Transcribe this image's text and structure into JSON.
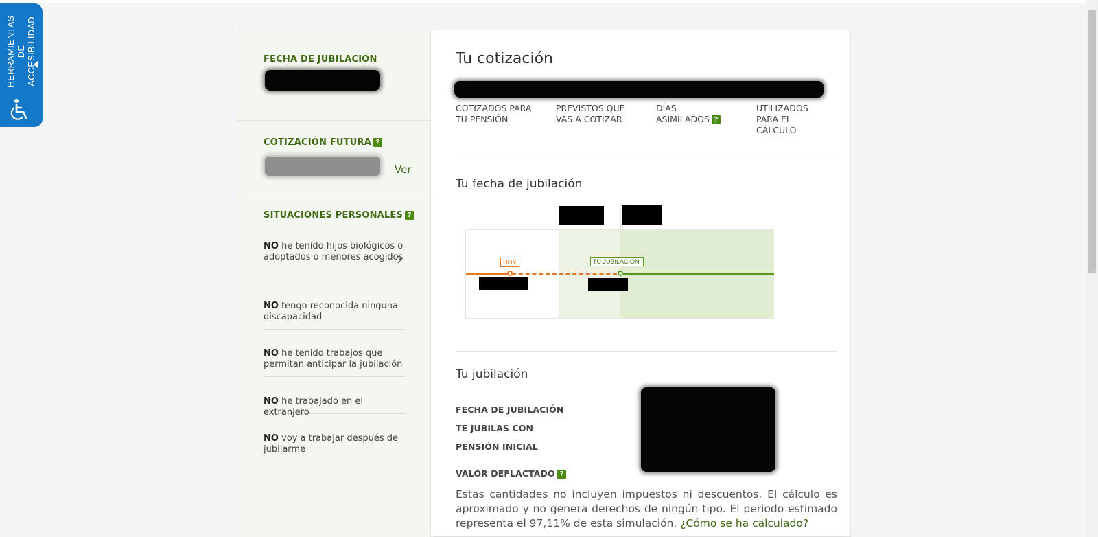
{
  "accessibility": {
    "label": "Herramientas de accesibilidad"
  },
  "sidebar": {
    "retirement_date": {
      "label": "FECHA DE JUBILACIÓN"
    },
    "future_contribution": {
      "label": "COTIZACIÓN FUTURA",
      "help": "?",
      "link": "Ver"
    },
    "personal_situations": {
      "label": "SITUACIONES PERSONALES",
      "help": "?",
      "items": [
        {
          "prefix": "NO",
          "text": "he tenido hijos biológicos o adoptados o menores acogidos"
        },
        {
          "prefix": "NO",
          "text": "tengo reconocida ninguna discapacidad"
        },
        {
          "prefix": "NO",
          "text": "he tenido trabajos que permitan anticipar la jubilación"
        },
        {
          "prefix": "NO",
          "text": "he trabajado en el extranjero"
        },
        {
          "prefix": "NO",
          "text": "voy a trabajar después de jubilarme"
        }
      ]
    }
  },
  "main": {
    "contribution": {
      "title": "Tu cotización",
      "stats": [
        {
          "label": "COTIZADOS PARA TU PENSIÓN"
        },
        {
          "label": "PREVISTOS QUE VAS A COTIZAR"
        },
        {
          "label": "DÍAS ASIMILADOS",
          "help": "?"
        },
        {
          "label": "UTILIZADOS PARA EL CÁLCULO"
        }
      ]
    },
    "retirement_timeline": {
      "title": "Tu fecha de jubilación",
      "today_tag": "HOY",
      "retirement_tag": "TU JUBILACION"
    },
    "retirement": {
      "title": "Tu jubilación",
      "rows": [
        {
          "label": "FECHA DE JUBILACIÓN"
        },
        {
          "label": "TE JUBILAS CON"
        },
        {
          "label": "PENSIÓN INICIAL"
        },
        {
          "label": "VALOR DEFLACTADO",
          "help": "?"
        }
      ],
      "disclaimer": "Estas cantidades no incluyen impuestos ni descuentos. El cálculo es aproximado y no genera derechos de ningún tipo. El periodo estimado representa el 97,11% de esta simulación.",
      "disclaimer_link": "¿Cómo se ha calculado?"
    }
  },
  "colors": {
    "accent_green": "#3f6a12",
    "timeline_orange": "#e87722",
    "a11y_blue": "#1478c8"
  }
}
